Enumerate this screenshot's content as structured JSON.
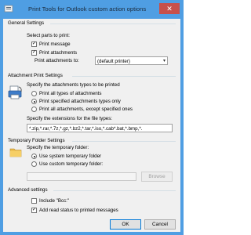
{
  "window": {
    "title": "Print Tools for Outlook custom action options",
    "close_glyph": "✕"
  },
  "general": {
    "section_title": "General Settings",
    "select_label": "Select parts to print:",
    "print_message": {
      "label": "Print message",
      "checked": true
    },
    "print_attachments": {
      "label": "Print attachments",
      "checked": true
    },
    "printer_label": "Print attachments to:",
    "printer_value": "(default printer)"
  },
  "attachment": {
    "section_title": "Attachment Print Settings",
    "specify_label": "Specify the attachments types to be printed",
    "options": [
      {
        "label": "Print all types of attachments",
        "selected": false
      },
      {
        "label": "Print specified attachments types only",
        "selected": true
      },
      {
        "label": "Print all attachments, except specified ones",
        "selected": false
      }
    ],
    "extensions_label": "Specify the extensions for the file types:",
    "extensions_value": "*.zip,*.rar,*.7z,*.gz,*.bz2,*.tar,*.iso,*.cab*.bat,*.bmp,*."
  },
  "temp": {
    "section_title": "Temporary Folder Settings",
    "specify_label": "Specify the temporary folder:",
    "options": [
      {
        "label": "Use system temporary folder",
        "selected": true
      },
      {
        "label": "Use custom temporary folder:",
        "selected": false
      }
    ],
    "folder_value": "",
    "browse_label": "Browse"
  },
  "advanced": {
    "section_title": "Advanced settings",
    "include_bcc": {
      "label": "Include \"Bcc:\"",
      "checked": false
    },
    "read_status": {
      "label": "Add read status to printed messages",
      "checked": true
    }
  },
  "buttons": {
    "ok": "OK",
    "cancel": "Cancel"
  },
  "colors": {
    "title_bar": "#4f9ee3",
    "client_bg": "#f0f0f0",
    "close_bg": "#c7504a",
    "accent": "#0078d7"
  },
  "icons": [
    "app-icon",
    "close-icon",
    "printer-attachment-icon",
    "folder-icon",
    "chevron-down-icon",
    "checkmark-icon"
  ]
}
